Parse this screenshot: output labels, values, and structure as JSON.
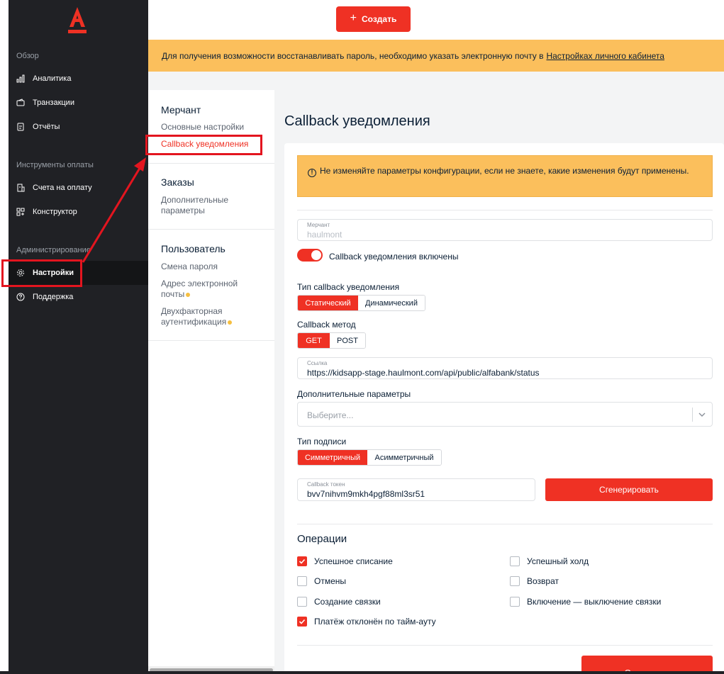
{
  "colors": {
    "accent": "#ef3124",
    "sidebar_bg": "#202125",
    "warning_bg": "#fbbf5c",
    "annotation": "#e3151f"
  },
  "sidebar": {
    "logo": "А",
    "sections": [
      {
        "title": "Обзор",
        "items": [
          {
            "label": "Аналитика",
            "icon": "chart-icon"
          },
          {
            "label": "Транзакции",
            "icon": "wallet-icon"
          },
          {
            "label": "Отчёты",
            "icon": "document-icon"
          }
        ]
      },
      {
        "title": "Инструменты оплаты",
        "items": [
          {
            "label": "Счета на оплату",
            "icon": "invoice-icon"
          },
          {
            "label": "Конструктор",
            "icon": "grid-plus-icon"
          }
        ]
      },
      {
        "title": "Администрирование",
        "items": [
          {
            "label": "Настройки",
            "icon": "gear-icon",
            "active": true
          },
          {
            "label": "Поддержка",
            "icon": "help-icon"
          }
        ]
      }
    ]
  },
  "topbar": {
    "create_label": "Создать"
  },
  "banner": {
    "text": "Для получения возможности восстанавливать пароль, необходимо указать электронную почту в",
    "link": "Настройках личного кабинета"
  },
  "settings_menu": {
    "groups": [
      {
        "title": "Мерчант",
        "items": [
          {
            "label": "Основные настройки"
          },
          {
            "label": "Callback уведомления",
            "active": true
          }
        ]
      },
      {
        "title": "Заказы",
        "items": [
          {
            "label": "Дополнительные параметры"
          }
        ]
      },
      {
        "title": "Пользователь",
        "items": [
          {
            "label": "Смена пароля"
          },
          {
            "label": "Адрес электронной почты",
            "dot": true
          },
          {
            "label": "Двухфакторная аутентификация",
            "dot": true
          }
        ]
      }
    ]
  },
  "main": {
    "title": "Callback уведомления",
    "warning": "Не изменяйте параметры конфигурации, если не знаете, какие изменения будут применены.",
    "merchant_field": {
      "label": "Мерчант",
      "value": "haulmont"
    },
    "toggle_label": "Callback уведомления включены",
    "toggle_on": true,
    "callback_type": {
      "label": "Тип callback уведомления",
      "options": [
        "Статический",
        "Динамический"
      ],
      "selected": "Статический"
    },
    "callback_method": {
      "label": "Callback метод",
      "options": [
        "GET",
        "POST"
      ],
      "selected": "GET"
    },
    "url_field": {
      "label": "Ссылка",
      "value": "https://kidsapp-stage.haulmont.com/api/public/alfabank/status"
    },
    "extra_params": {
      "label": "Дополнительные параметры",
      "placeholder": "Выберите..."
    },
    "signature_type": {
      "label": "Тип подписи",
      "options": [
        "Симметричный",
        "Асимметричный"
      ],
      "selected": "Симметричный"
    },
    "token_field": {
      "label": "Callback токен",
      "value": "bvv7nihvm9mkh4pgf88ml3sr51"
    },
    "generate_label": "Сгенерировать",
    "operations": {
      "title": "Операции",
      "items": [
        {
          "label": "Успешное списание",
          "checked": true
        },
        {
          "label": "Успешный холд",
          "checked": false
        },
        {
          "label": "Отмены",
          "checked": false
        },
        {
          "label": "Возврат",
          "checked": false
        },
        {
          "label": "Создание связки",
          "checked": false
        },
        {
          "label": "Включение — выключение связки",
          "checked": false
        },
        {
          "label": "Платёж отклонён по тайм-ауту",
          "checked": true
        }
      ]
    },
    "save_label": "Сохранить"
  }
}
